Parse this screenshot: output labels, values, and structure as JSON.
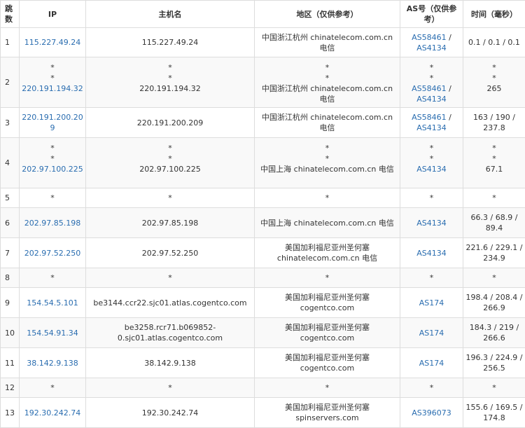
{
  "colors": {
    "link": "#2a6db0",
    "border": "#dddddd",
    "text": "#333333",
    "stripe": "#f9f9f9"
  },
  "headers": {
    "hop": "跳数",
    "ip": "IP",
    "host": "主机名",
    "region": "地区（仅供参考）",
    "as": "AS号（仅供参考）",
    "time": "时间（毫秒）"
  },
  "rows": [
    {
      "hop": "1",
      "ip": [
        "115.227.49.24"
      ],
      "host": [
        "115.227.49.24"
      ],
      "region": [
        "中国浙江杭州 chinatelecom.com.cn 电信"
      ],
      "as_links": [
        "AS58461",
        "AS4134"
      ],
      "as_stars": [],
      "time": [
        "0.1 / 0.1 / 0.1"
      ]
    },
    {
      "hop": "2",
      "ip": [
        "*",
        "*",
        "220.191.194.32"
      ],
      "host": [
        "*",
        "*",
        "220.191.194.32"
      ],
      "region": [
        "*",
        "*",
        "中国浙江杭州 chinatelecom.com.cn 电信"
      ],
      "as_links": [
        "AS58461",
        "AS4134"
      ],
      "as_stars": [
        "*",
        "*"
      ],
      "time": [
        "*",
        "*",
        "265"
      ]
    },
    {
      "hop": "3",
      "ip": [
        "220.191.200.209"
      ],
      "host": [
        "220.191.200.209"
      ],
      "region": [
        "中国浙江杭州 chinatelecom.com.cn 电信"
      ],
      "as_links": [
        "AS58461",
        "AS4134"
      ],
      "as_stars": [],
      "time": [
        "163 / 190 / 237.8"
      ]
    },
    {
      "hop": "4",
      "ip": [
        "*",
        "*",
        "202.97.100.225"
      ],
      "host": [
        "*",
        "*",
        "202.97.100.225"
      ],
      "region": [
        "*",
        "*",
        "中国上海 chinatelecom.com.cn 电信"
      ],
      "as_links": [
        "AS4134"
      ],
      "as_stars": [
        "*",
        "*"
      ],
      "time": [
        "*",
        "*",
        "67.1"
      ]
    },
    {
      "hop": "5",
      "ip": [
        "*"
      ],
      "host": [
        "*"
      ],
      "region": [
        "*"
      ],
      "as_links": [],
      "as_stars": [
        "*"
      ],
      "time": [
        "*"
      ]
    },
    {
      "hop": "6",
      "ip": [
        "202.97.85.198"
      ],
      "host": [
        "202.97.85.198"
      ],
      "region": [
        "中国上海 chinatelecom.com.cn 电信"
      ],
      "as_links": [
        "AS4134"
      ],
      "as_stars": [],
      "time": [
        "66.3 / 68.9 / 89.4"
      ]
    },
    {
      "hop": "7",
      "ip": [
        "202.97.52.250"
      ],
      "host": [
        "202.97.52.250"
      ],
      "region": [
        "美国加利福尼亚州圣何塞 chinatelecom.com.cn 电信"
      ],
      "as_links": [
        "AS4134"
      ],
      "as_stars": [],
      "time": [
        "221.6 / 229.1 / 234.9"
      ]
    },
    {
      "hop": "8",
      "ip": [
        "*"
      ],
      "host": [
        "*"
      ],
      "region": [
        "*"
      ],
      "as_links": [],
      "as_stars": [
        "*"
      ],
      "time": [
        "*"
      ]
    },
    {
      "hop": "9",
      "ip": [
        "154.54.5.101"
      ],
      "host": [
        "be3144.ccr22.sjc01.atlas.cogentco.com"
      ],
      "region": [
        "美国加利福尼亚州圣何塞 cogentco.com"
      ],
      "as_links": [
        "AS174"
      ],
      "as_stars": [],
      "time": [
        "198.4 / 208.4 / 266.9"
      ]
    },
    {
      "hop": "10",
      "ip": [
        "154.54.91.34"
      ],
      "host": [
        "be3258.rcr71.b069852-0.sjc01.atlas.cogentco.com"
      ],
      "region": [
        "美国加利福尼亚州圣何塞 cogentco.com"
      ],
      "as_links": [
        "AS174"
      ],
      "as_stars": [],
      "time": [
        "184.3 / 219 / 266.6"
      ]
    },
    {
      "hop": "11",
      "ip": [
        "38.142.9.138"
      ],
      "host": [
        "38.142.9.138"
      ],
      "region": [
        "美国加利福尼亚州圣何塞 cogentco.com"
      ],
      "as_links": [
        "AS174"
      ],
      "as_stars": [],
      "time": [
        "196.3 / 224.9 / 256.5"
      ]
    },
    {
      "hop": "12",
      "ip": [
        "*"
      ],
      "host": [
        "*"
      ],
      "region": [
        "*"
      ],
      "as_links": [],
      "as_stars": [
        "*"
      ],
      "time": [
        "*"
      ]
    },
    {
      "hop": "13",
      "ip": [
        "192.30.242.74"
      ],
      "host": [
        "192.30.242.74"
      ],
      "region": [
        "美国加利福尼亚州圣何塞 spinservers.com"
      ],
      "as_links": [
        "AS396073"
      ],
      "as_stars": [],
      "time": [
        "155.6 / 169.5 / 174.8"
      ]
    }
  ]
}
